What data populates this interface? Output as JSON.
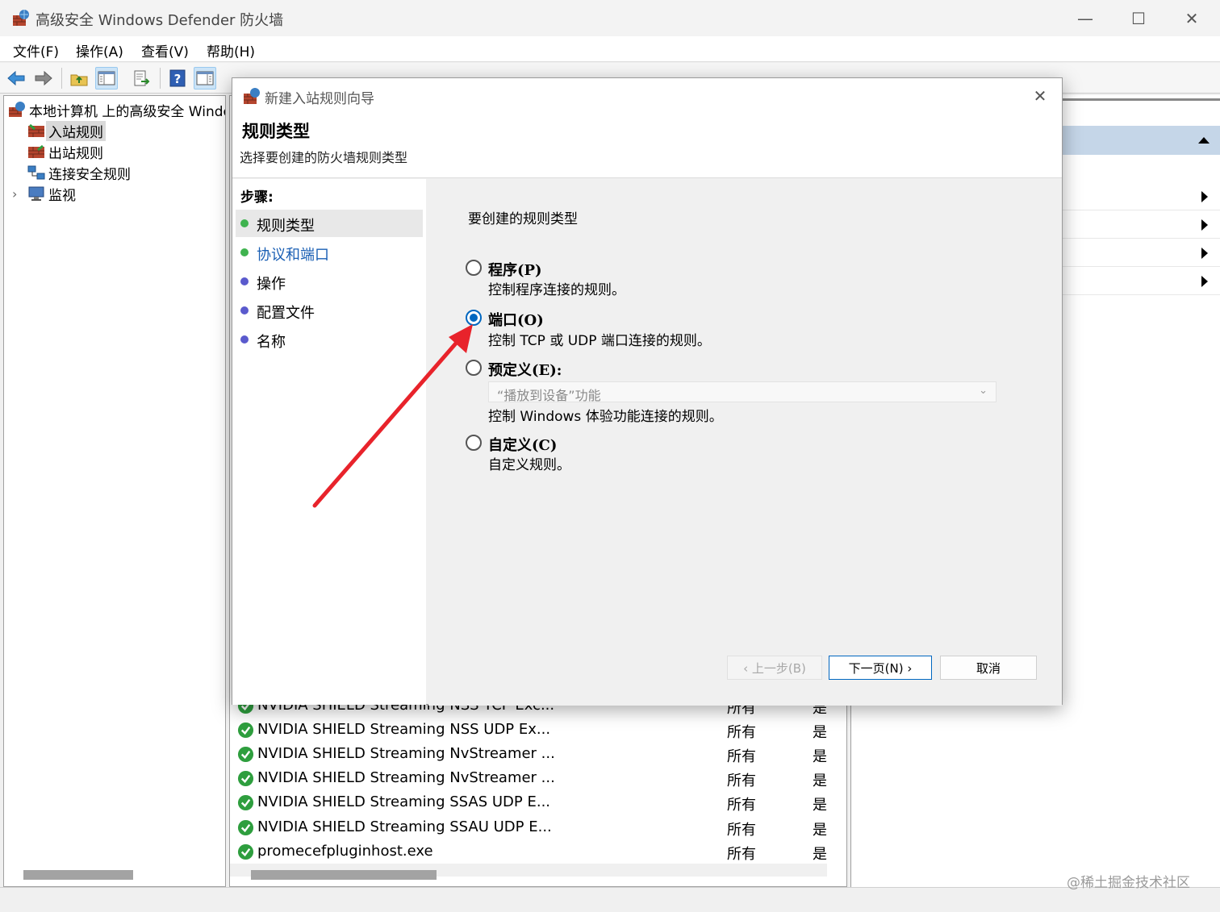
{
  "window": {
    "title": "高级安全 Windows Defender 防火墙",
    "minimize": "—",
    "maximize": "☐",
    "close": "✕"
  },
  "menu": [
    "文件(F)",
    "操作(A)",
    "查看(V)",
    "帮助(H)"
  ],
  "tree": {
    "root": "本地计算机 上的高级安全 Windows Defender 防火墙",
    "items": [
      {
        "label": "入站规则",
        "selected": true
      },
      {
        "label": "出站规则"
      },
      {
        "label": "连接安全规则"
      },
      {
        "label": "监视",
        "expander": "›"
      }
    ]
  },
  "rules_list": {
    "rows": [
      {
        "name": "NVIDIA SHIELD Streaming NSS TCP Exc...",
        "profile": "所有",
        "enabled": "是"
      },
      {
        "name": "NVIDIA SHIELD Streaming NSS UDP Ex...",
        "profile": "所有",
        "enabled": "是"
      },
      {
        "name": "NVIDIA SHIELD Streaming NvStreamer ...",
        "profile": "所有",
        "enabled": "是"
      },
      {
        "name": "NVIDIA SHIELD Streaming NvStreamer ...",
        "profile": "所有",
        "enabled": "是"
      },
      {
        "name": "NVIDIA SHIELD Streaming SSAS UDP E...",
        "profile": "所有",
        "enabled": "是"
      },
      {
        "name": "NVIDIA SHIELD Streaming SSAU UDP E...",
        "profile": "所有",
        "enabled": "是"
      },
      {
        "name": "promecefpluginhost.exe",
        "profile": "所有",
        "enabled": "是"
      }
    ]
  },
  "wizard": {
    "title": "新建入站规则向导",
    "close": "✕",
    "header_title": "规则类型",
    "header_subtitle": "选择要创建的防火墙规则类型",
    "steps_title": "步骤:",
    "steps": [
      {
        "label": "规则类型",
        "current": true,
        "dot_color": "#3fb34f",
        "text_color": "#000000"
      },
      {
        "label": "协议和端口",
        "dot_color": "#3fb34f",
        "text_color": "#1a5fb4"
      },
      {
        "label": "操作",
        "dot_color": "#5a5acd",
        "text_color": "#000000"
      },
      {
        "label": "配置文件",
        "dot_color": "#5a5acd",
        "text_color": "#000000"
      },
      {
        "label": "名称",
        "dot_color": "#5a5acd",
        "text_color": "#000000"
      }
    ],
    "question": "要创建的规则类型",
    "options": [
      {
        "label": "程序(P)",
        "desc": "控制程序连接的规则。",
        "checked": false
      },
      {
        "label": "端口(O)",
        "desc": "控制 TCP 或 UDP 端口连接的规则。",
        "checked": true
      },
      {
        "label": "预定义(E):",
        "desc": "控制 Windows 体验功能连接的规则。",
        "checked": false
      },
      {
        "label": "自定义(C)",
        "desc": "自定义规则。",
        "checked": false
      }
    ],
    "predefined_value": "“播放到设备”功能",
    "buttons": {
      "back": "‹ 上一步(B)",
      "next": "下一页(N) ›",
      "cancel": "取消"
    }
  },
  "watermark": "@稀土掘金技术社区",
  "colors": {
    "accent": "#0067c0",
    "annotation_arrow": "#e8232b",
    "check_green": "#2e9e3e"
  }
}
